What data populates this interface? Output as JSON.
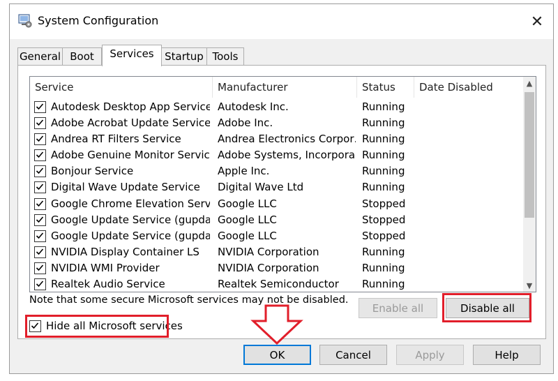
{
  "window": {
    "title": "System Configuration"
  },
  "tabs": [
    {
      "label": "General"
    },
    {
      "label": "Boot"
    },
    {
      "label": "Services"
    },
    {
      "label": "Startup"
    },
    {
      "label": "Tools"
    }
  ],
  "active_tab": "Services",
  "columns": [
    "Service",
    "Manufacturer",
    "Status",
    "Date Disabled"
  ],
  "services": [
    {
      "name": "Autodesk Desktop App Service",
      "manufacturer": "Autodesk Inc.",
      "status": "Running",
      "date_disabled": "",
      "checked": true
    },
    {
      "name": "Adobe Acrobat Update Service",
      "manufacturer": "Adobe Inc.",
      "status": "Running",
      "date_disabled": "",
      "checked": true
    },
    {
      "name": "Andrea RT Filters Service",
      "manufacturer": "Andrea Electronics Corpor…",
      "status": "Running",
      "date_disabled": "",
      "checked": true
    },
    {
      "name": "Adobe Genuine Monitor Service",
      "manufacturer": "Adobe Systems, Incorpora…",
      "status": "Running",
      "date_disabled": "",
      "checked": true
    },
    {
      "name": "Bonjour Service",
      "manufacturer": "Apple Inc.",
      "status": "Running",
      "date_disabled": "",
      "checked": true
    },
    {
      "name": "Digital Wave Update Service",
      "manufacturer": "Digital Wave Ltd",
      "status": "Running",
      "date_disabled": "",
      "checked": true
    },
    {
      "name": "Google Chrome Elevation Service",
      "manufacturer": "Google LLC",
      "status": "Stopped",
      "date_disabled": "",
      "checked": true
    },
    {
      "name": "Google Update Service (gupdate)",
      "manufacturer": "Google LLC",
      "status": "Stopped",
      "date_disabled": "",
      "checked": true
    },
    {
      "name": "Google Update Service (gupdatem)",
      "manufacturer": "Google LLC",
      "status": "Stopped",
      "date_disabled": "",
      "checked": true
    },
    {
      "name": "NVIDIA Display Container LS",
      "manufacturer": "NVIDIA Corporation",
      "status": "Running",
      "date_disabled": "",
      "checked": true
    },
    {
      "name": "NVIDIA WMI Provider",
      "manufacturer": "NVIDIA Corporation",
      "status": "Running",
      "date_disabled": "",
      "checked": true
    },
    {
      "name": "Realtek Audio Service",
      "manufacturer": "Realtek Semiconductor",
      "status": "Running",
      "date_disabled": "",
      "checked": true
    }
  ],
  "note": "Note that some secure Microsoft services may not be disabled.",
  "buttons": {
    "enable_all": "Enable all",
    "disable_all": "Disable all",
    "ok": "OK",
    "cancel": "Cancel",
    "apply": "Apply",
    "help": "Help"
  },
  "hide_microsoft": {
    "label": "Hide all Microsoft services",
    "checked": true
  },
  "colors": {
    "highlight": "#e11e2a",
    "ok_border": "#0078d7"
  }
}
